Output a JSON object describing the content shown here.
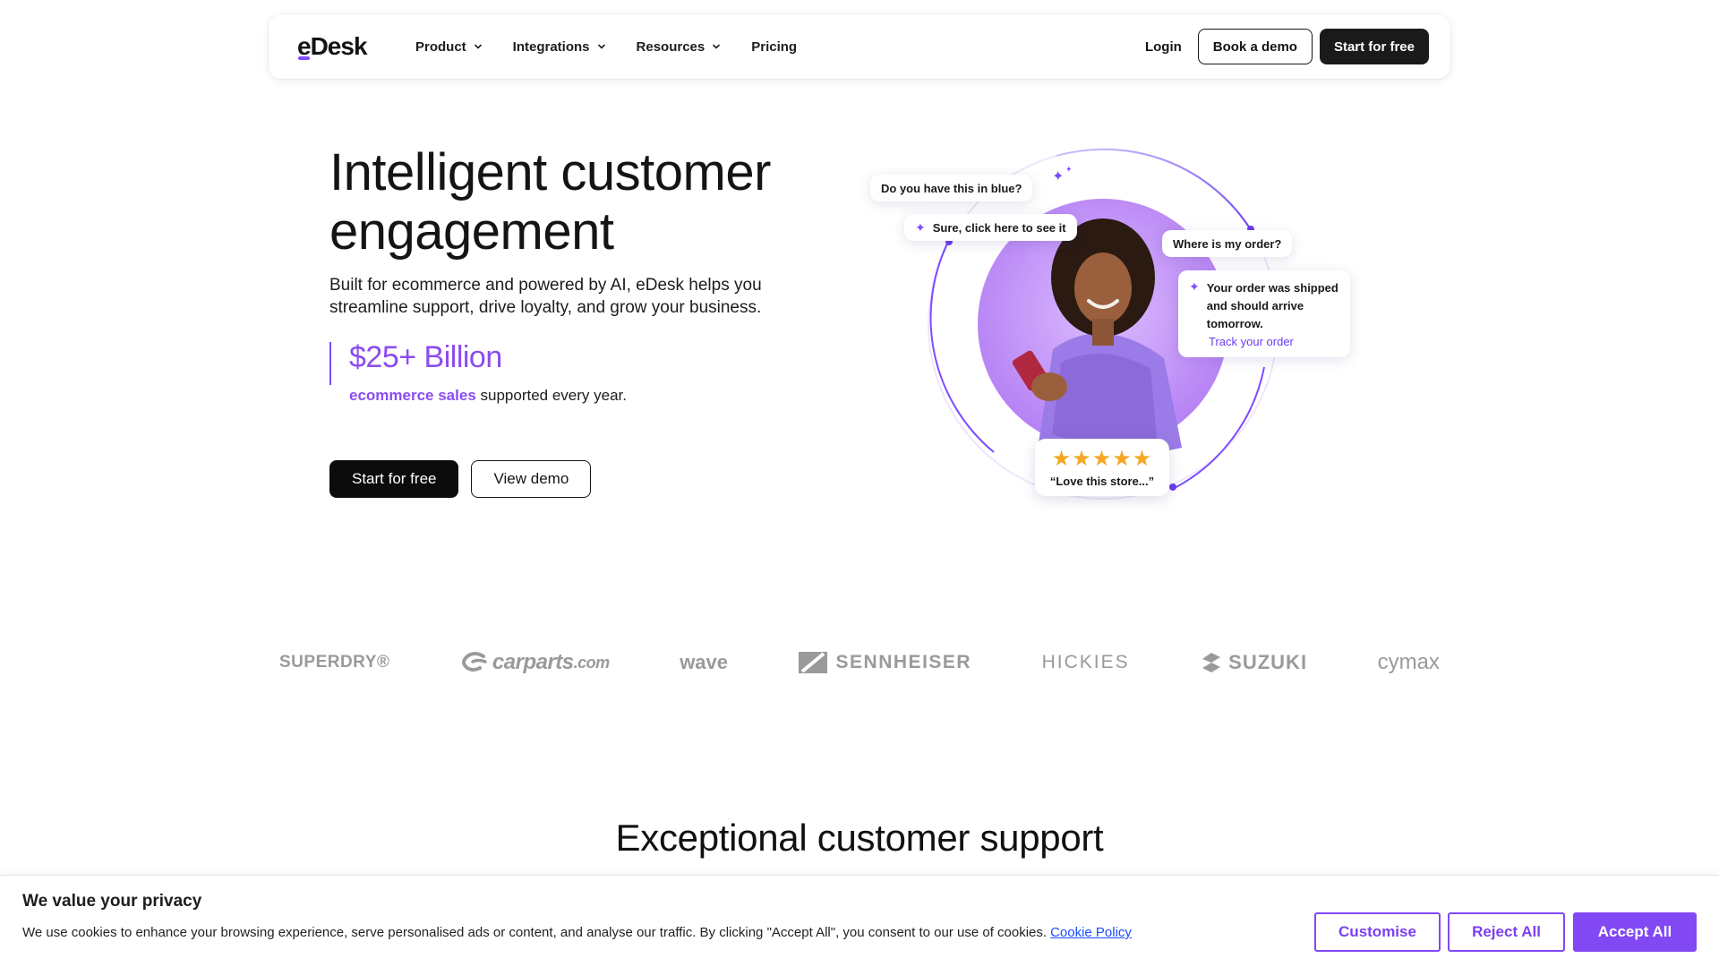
{
  "nav": {
    "logo": "eDesk",
    "items": [
      {
        "label": "Product",
        "has_dropdown": true
      },
      {
        "label": "Integrations",
        "has_dropdown": true
      },
      {
        "label": "Resources",
        "has_dropdown": true
      },
      {
        "label": "Pricing",
        "has_dropdown": false
      }
    ],
    "login": "Login",
    "book_demo": "Book a demo",
    "start_free": "Start for free"
  },
  "hero": {
    "title": "Intelligent customer engagement",
    "subtitle": "Built for ecommerce and powered by AI, eDesk helps you streamline support, drive loyalty, and grow your business.",
    "stat_value": "$25+ Billion",
    "stat_highlight": "ecommerce sales",
    "stat_rest": "supported every year.",
    "cta_primary": "Start for free",
    "cta_secondary": "View demo"
  },
  "illustration": {
    "q1": "Do you have this in blue?",
    "a1": "Sure, click here to see it",
    "q2": "Where is my order?",
    "a2": "Your order was shipped and should arrive tomorrow.",
    "a2_link": "Track your order",
    "stars": "★★★★★",
    "rating_value": 5,
    "review": "“Love this store...”"
  },
  "logos": {
    "superdry": "SUPERDRY®",
    "carparts_main": "carparts",
    "carparts_suffix": ".com",
    "wave": "wave",
    "sennheiser": "SENNHEISER",
    "hickies": "HICKIES",
    "suzuki": "SUZUKI",
    "cymax": "cymax"
  },
  "section": {
    "title": "Exceptional customer support"
  },
  "cookie": {
    "title": "We value your privacy",
    "text": "We use cookies to enhance your browsing experience, serve personalised ads or content, and analyse our traffic. By clicking \"Accept All\", you consent to our use of cookies.",
    "policy_link": "Cookie Policy",
    "customise": "Customise",
    "reject": "Reject All",
    "accept": "Accept All"
  },
  "colors": {
    "accent": "#8148f4",
    "text": "#141414",
    "star": "#f5a623"
  }
}
